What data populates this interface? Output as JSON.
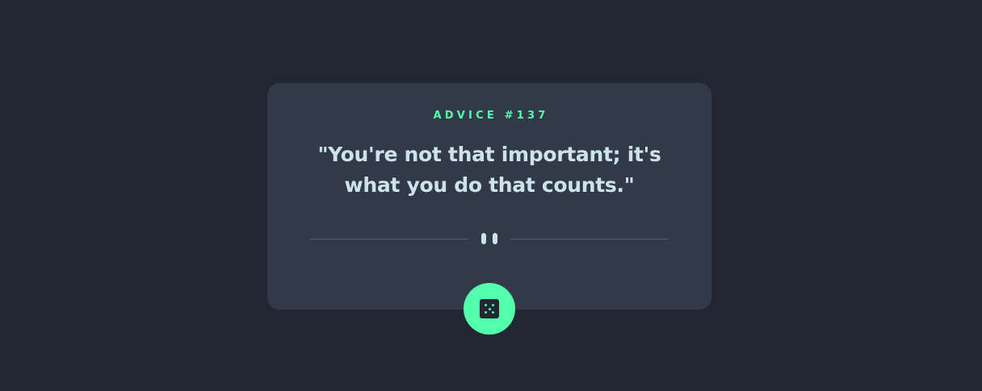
{
  "advice": {
    "label": "ADVICE #137",
    "quote": "\"You're not that important; it's what you do that counts.\""
  },
  "icons": {
    "divider": "pause-icon",
    "button": "dice-icon"
  },
  "colors": {
    "background": "#202632",
    "card": "#323a49",
    "accent": "#53ffaa",
    "text": "#cee3e9",
    "divider": "#4f5d74"
  }
}
